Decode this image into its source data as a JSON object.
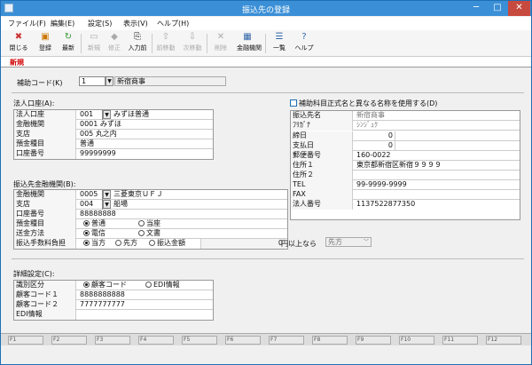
{
  "window": {
    "title": "振込先の登録",
    "min": "─",
    "max": "□",
    "close": "✕"
  },
  "menu": [
    "ファイル(F)",
    "編集(E)",
    "設定(S)",
    "表示(V)",
    "ヘルプ(H)"
  ],
  "toolbar": {
    "close": "閉じる",
    "register": "登録",
    "refresh": "最新",
    "new": "新規",
    "edit": "修正",
    "input_pre": "入力前",
    "prev": "前移動",
    "next": "次移動",
    "delete": "削除",
    "bank": "金融機関",
    "list": "一覧",
    "help": "ヘルプ"
  },
  "mode": "新規",
  "aux": {
    "label": "補助コード(K)",
    "code": "1",
    "name": "新宿商事"
  },
  "corp": {
    "section": "法人口座(A):",
    "rows": [
      {
        "label": "法人口座",
        "code": "001",
        "value": "みずほ普通"
      },
      {
        "label": "金融機関",
        "value": "0001 みずほ"
      },
      {
        "label": "支店",
        "value": "005 丸之内"
      },
      {
        "label": "預金種目",
        "value": "普通"
      },
      {
        "label": "口座番号",
        "value": "99999999"
      }
    ]
  },
  "transfer": {
    "section": "振込先金融機関(B):",
    "bank": {
      "label": "金融機関",
      "code": "0005",
      "value": "三菱東京ＵＦＪ"
    },
    "branch": {
      "label": "支店",
      "code": "004",
      "value": "船場"
    },
    "account": {
      "label": "口座番号",
      "value": "88888888"
    },
    "deposit": {
      "label": "預金種目",
      "opt1": "普通",
      "opt2": "当座"
    },
    "send": {
      "label": "送金方法",
      "opt1": "電信",
      "opt2": "文書"
    },
    "fee": {
      "label": "振込手数料負担",
      "opt1": "当方",
      "opt2": "先方",
      "opt3": "振込金額",
      "amount": "0",
      "suffix": "円以上なら",
      "select": "先方"
    }
  },
  "right": {
    "checkbox": "補助科目正式名と異なる名称を使用する(D)",
    "rows": [
      {
        "label": "振込先名",
        "value": "新宿商事"
      },
      {
        "label": "ﾌﾘｶﾞﾅ",
        "value": "ｼﾝｼﾞｭｸ"
      },
      {
        "label": "締日",
        "value": "0"
      },
      {
        "label": "支払日",
        "value": "0"
      },
      {
        "label": "郵便番号",
        "value": "160-0022"
      },
      {
        "label": "住所１",
        "value": "東京都新宿区新宿９９９９"
      },
      {
        "label": "住所２",
        "value": ""
      },
      {
        "label": "TEL",
        "value": "99-9999-9999"
      },
      {
        "label": "FAX",
        "value": ""
      },
      {
        "label": "法人番号",
        "value": "1137522877350"
      }
    ]
  },
  "detail": {
    "section": "詳細設定(C):",
    "kind": {
      "label": "識別区分",
      "opt1": "顧客コード",
      "opt2": "EDI情報"
    },
    "cust1": {
      "label": "顧客コード１",
      "value": "8888888888"
    },
    "cust2": {
      "label": "顧客コード２",
      "value": "7777777777"
    },
    "edi": {
      "label": "EDI情報",
      "value": ""
    }
  },
  "fkeys": [
    "F1",
    "F2",
    "F3",
    "F4",
    "F5",
    "F6",
    "F7",
    "F8",
    "F9",
    "F10",
    "F11",
    "F12"
  ]
}
